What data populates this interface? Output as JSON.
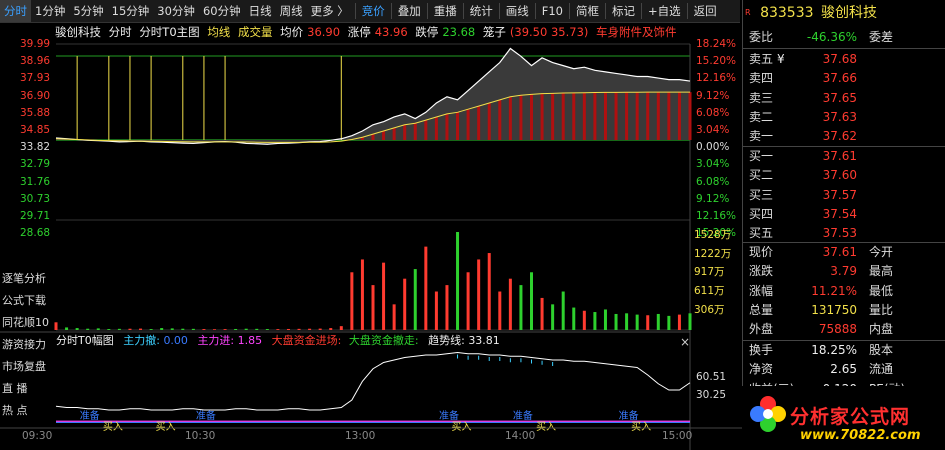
{
  "toolbar": {
    "tabs": [
      "分时",
      "1分钟",
      "5分钟",
      "15分钟",
      "30分钟",
      "60分钟",
      "日线",
      "周线",
      "更多 〉"
    ],
    "tools": [
      "竞价",
      "叠加",
      "重播",
      "统计",
      "画线",
      "F10",
      "简框",
      "标记",
      "+自选",
      "返回"
    ]
  },
  "chart_header": {
    "stock_name": "骏创科技",
    "view1": "分时",
    "view2": "分时T0主图",
    "avg_line": "均线",
    "volume": "成交量",
    "avg_label": "均价",
    "avg_value": "36.90",
    "limit_up_label": "涨停",
    "limit_up_value": "43.96",
    "limit_down_label": "跌停",
    "limit_down_value": "23.68",
    "cage_label": "笼子",
    "cage_value": "(39.50 35.73)",
    "industry": "车身附件及饰件"
  },
  "price_axis": {
    "left": [
      "39.99",
      "38.96",
      "37.93",
      "36.90",
      "35.88",
      "34.85",
      "33.82",
      "32.79",
      "31.76",
      "30.73",
      "29.71",
      "28.68"
    ],
    "right": [
      "18.24%",
      "15.20%",
      "12.16%",
      "9.12%",
      "6.08%",
      "3.04%",
      "0.00%",
      "3.04%",
      "6.08%",
      "9.12%",
      "12.16%",
      "15.20%"
    ]
  },
  "volume_axis": [
    "1528万",
    "1222万",
    "917万",
    "611万",
    "306万"
  ],
  "indicator": {
    "title": "分时T0幅图",
    "main_force_label": "主力撤:",
    "main_force_value": "0.00",
    "main_in_label": "主力进:",
    "main_in_value": "1.85",
    "market_in_label": "大盘资金进场:",
    "market_out_label": "大盘资金撤走:",
    "trend_label": "趋势线:",
    "trend_value": "33.81",
    "axis": [
      "60.51",
      "30.25"
    ],
    "signals": {
      "ready": "准备",
      "buy": "买入"
    },
    "close": "×"
  },
  "time_axis": [
    "09:30",
    "10:30",
    "13:00",
    "14:00",
    "15:00"
  ],
  "left_menu": [
    "逐笔分析",
    "公式下载",
    "同花顺10",
    "游资接力",
    "市场复盘",
    "直  播",
    "热  点"
  ],
  "quote": {
    "code": "833533",
    "name": "骏创科技",
    "ratio_label": "委比",
    "ratio_value": "-46.36%",
    "diff_label": "委差",
    "asks": [
      {
        "label": "卖五",
        "sym": "¥",
        "price": "37.68"
      },
      {
        "label": "卖四",
        "sym": "",
        "price": "37.66"
      },
      {
        "label": "卖三",
        "sym": "",
        "price": "37.65"
      },
      {
        "label": "卖二",
        "sym": "",
        "price": "37.63"
      },
      {
        "label": "卖一",
        "sym": "",
        "price": "37.62"
      }
    ],
    "bids": [
      {
        "label": "买一",
        "price": "37.61"
      },
      {
        "label": "买二",
        "price": "37.60"
      },
      {
        "label": "买三",
        "price": "37.57"
      },
      {
        "label": "买四",
        "price": "37.54"
      },
      {
        "label": "买五",
        "price": "37.53"
      }
    ],
    "stats": [
      {
        "k": "现价",
        "v": "37.61",
        "k2": "今开",
        "c": "red"
      },
      {
        "k": "涨跌",
        "v": "3.79",
        "k2": "最高",
        "c": "red"
      },
      {
        "k": "涨幅",
        "v": "11.21%",
        "k2": "最低",
        "c": "red"
      },
      {
        "k": "总量",
        "v": "131750",
        "k2": "量比",
        "c": "yellow"
      },
      {
        "k": "外盘",
        "v": "75888",
        "k2": "内盘",
        "c": "red"
      }
    ],
    "stats2": [
      {
        "k": "换手",
        "v": "18.25%",
        "k2": "股本",
        "c": "white"
      },
      {
        "k": "净资",
        "v": "2.65",
        "k2": "流通",
        "c": "white"
      },
      {
        "k": "收益(三)",
        "v": "0.120",
        "k2": "PE(动)",
        "c": "white"
      }
    ]
  },
  "logo": {
    "title": "分析家公式网",
    "url": "www.70822.com"
  },
  "colors": {
    "up": "#ff3b30",
    "down": "#2ed12e",
    "price_line": "#ffffff",
    "avg_line": "#f2e04a",
    "toolbar_bg": "#1a1a1a"
  },
  "chart_data": {
    "type": "line",
    "title": "骏创科技 分时",
    "x_ticks": [
      "09:30",
      "10:30",
      "13:00",
      "14:00",
      "15:00"
    ],
    "y_range": [
      28.68,
      39.99
    ],
    "base_price": 33.82,
    "price": [
      33.95,
      33.9,
      33.85,
      33.8,
      33.78,
      33.75,
      33.7,
      33.72,
      33.75,
      33.7,
      33.68,
      33.65,
      33.62,
      33.6,
      33.65,
      33.7,
      33.72,
      33.68,
      33.6,
      33.58,
      33.55,
      33.6,
      33.62,
      33.65,
      33.7,
      33.72,
      33.8,
      33.9,
      34.1,
      34.4,
      34.8,
      35.0,
      35.3,
      35.5,
      35.2,
      35.6,
      36.2,
      36.6,
      36.4,
      37.0,
      37.6,
      38.2,
      38.8,
      39.7,
      39.2,
      38.6,
      39.1,
      38.8,
      38.6,
      38.4,
      38.5,
      38.3,
      38.2,
      38.1,
      38.0,
      37.9,
      37.9,
      37.8,
      37.7,
      37.7,
      37.61
    ],
    "avg": [
      33.9,
      33.88,
      33.85,
      33.83,
      33.8,
      33.78,
      33.77,
      33.76,
      33.75,
      33.74,
      33.73,
      33.72,
      33.71,
      33.7,
      33.7,
      33.7,
      33.7,
      33.7,
      33.69,
      33.68,
      33.67,
      33.67,
      33.67,
      33.67,
      33.68,
      33.68,
      33.7,
      33.75,
      33.85,
      34.0,
      34.2,
      34.4,
      34.6,
      34.8,
      34.9,
      35.1,
      35.3,
      35.5,
      35.6,
      35.8,
      36.0,
      36.2,
      36.4,
      36.6,
      36.7,
      36.75,
      36.8,
      36.82,
      36.84,
      36.85,
      36.86,
      36.87,
      36.88,
      36.88,
      36.89,
      36.89,
      36.9,
      36.9,
      36.9,
      36.9,
      36.9
    ],
    "volume": [
      120,
      40,
      30,
      20,
      25,
      15,
      18,
      20,
      22,
      15,
      30,
      25,
      20,
      18,
      15,
      12,
      14,
      16,
      20,
      18,
      15,
      14,
      16,
      18,
      20,
      22,
      30,
      60,
      900,
      1100,
      700,
      1050,
      400,
      800,
      950,
      1300,
      600,
      700,
      1528,
      900,
      1100,
      1200,
      600,
      800,
      700,
      900,
      500,
      400,
      600,
      350,
      300,
      280,
      320,
      250,
      260,
      240,
      230,
      250,
      220,
      240,
      260
    ],
    "trend": [
      15,
      14,
      14,
      13,
      13,
      12,
      12,
      13,
      13,
      12,
      12,
      12,
      13,
      13,
      12,
      12,
      12,
      13,
      13,
      12,
      12,
      12,
      13,
      13,
      12,
      12,
      13,
      14,
      20,
      35,
      45,
      50,
      52,
      54,
      55,
      56,
      56,
      57,
      58,
      57,
      57,
      56,
      56,
      55,
      55,
      54,
      53,
      52,
      52,
      51,
      51,
      50,
      49,
      48,
      47,
      46,
      40,
      33,
      28,
      28,
      33.81
    ],
    "ready_signals": [
      3,
      14,
      37,
      44,
      54
    ],
    "buy_signals": [
      5,
      10,
      38,
      46,
      55
    ]
  }
}
